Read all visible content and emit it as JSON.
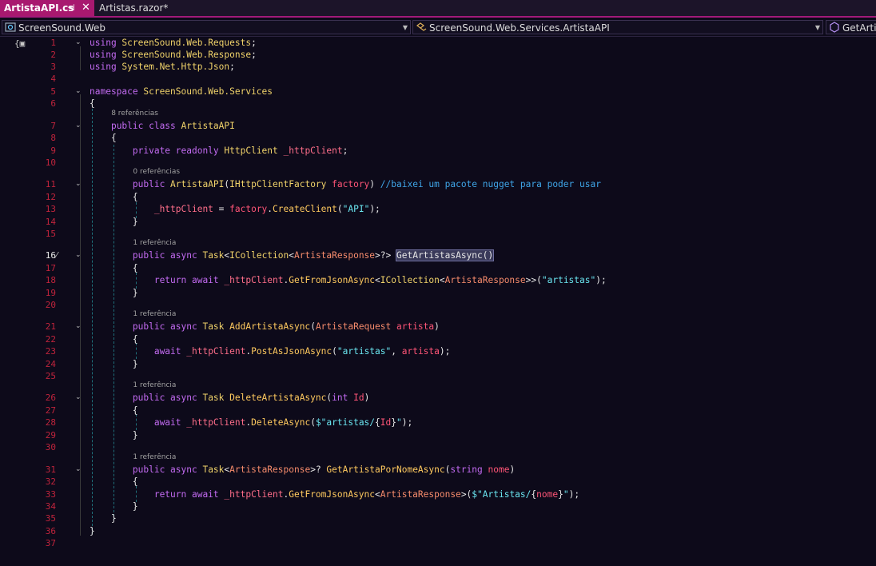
{
  "tabs": [
    {
      "label": "ArtistaAPI.cs",
      "active": true
    },
    {
      "label": "Artistas.razor*",
      "active": false
    }
  ],
  "tab_pin_glyph": "⊣",
  "tab_close_glyph": "✕",
  "nav": {
    "project": "ScreenSound.Web",
    "type": "ScreenSound.Web.Services.ArtistaAPI",
    "member": "GetArtist"
  },
  "colors": {
    "accent": "#a8196f",
    "line_number": "#c0243c",
    "keyword": "#c36bf2",
    "string": "#6ae5f0",
    "comment": "#3fa5e8"
  },
  "editor": {
    "current_line": 16,
    "lines": [
      {
        "n": "1",
        "code": [
          [
            "kw",
            "using "
          ],
          [
            "cls",
            "ScreenSound.Web.Requests"
          ],
          [
            "pl",
            ";"
          ]
        ]
      },
      {
        "n": "2",
        "code": [
          [
            "kw",
            "using "
          ],
          [
            "cls",
            "ScreenSound.Web.Response"
          ],
          [
            "pl",
            ";"
          ]
        ]
      },
      {
        "n": "3",
        "code": [
          [
            "kw",
            "using "
          ],
          [
            "cls",
            "System.Net.Http.Json"
          ],
          [
            "pl",
            ";"
          ]
        ]
      },
      {
        "n": "4",
        "code": []
      },
      {
        "n": "5",
        "code": [
          [
            "kw",
            "namespace "
          ],
          [
            "cls",
            "ScreenSound.Web.Services"
          ]
        ]
      },
      {
        "n": "6",
        "code": [
          [
            "pl",
            "{"
          ]
        ]
      },
      {
        "n": "7",
        "lens": "8 referências",
        "code": [
          [
            "pl",
            "    "
          ],
          [
            "kw",
            "public class "
          ],
          [
            "cls",
            "ArtistaAPI"
          ]
        ]
      },
      {
        "n": "8",
        "code": [
          [
            "pl",
            "    {"
          ]
        ]
      },
      {
        "n": "9",
        "code": [
          [
            "pl",
            "        "
          ],
          [
            "kw",
            "private readonly "
          ],
          [
            "cls",
            "HttpClient "
          ],
          [
            "fld",
            "_httpClient"
          ],
          [
            "pl",
            ";"
          ]
        ]
      },
      {
        "n": "10",
        "code": []
      },
      {
        "n": "11",
        "lens": "0 referências",
        "code": [
          [
            "pl",
            "        "
          ],
          [
            "kw",
            "public "
          ],
          [
            "cls",
            "ArtistaAPI"
          ],
          [
            "pl",
            "("
          ],
          [
            "cls",
            "IHttpClientFactory "
          ],
          [
            "par",
            "factory"
          ],
          [
            "pl",
            ") "
          ],
          [
            "cm",
            "//baixei um pacote nugget para poder usar"
          ]
        ]
      },
      {
        "n": "12",
        "code": [
          [
            "pl",
            "        {"
          ]
        ]
      },
      {
        "n": "13",
        "code": [
          [
            "pl",
            "            "
          ],
          [
            "fld",
            "_httpClient"
          ],
          [
            "pl",
            " = "
          ],
          [
            "par",
            "factory"
          ],
          [
            "pl",
            "."
          ],
          [
            "mth",
            "CreateClient"
          ],
          [
            "pl",
            "("
          ],
          [
            "str",
            "\"API\""
          ],
          [
            "pl",
            ");"
          ]
        ]
      },
      {
        "n": "14",
        "code": [
          [
            "pl",
            "        }"
          ]
        ]
      },
      {
        "n": "15",
        "code": []
      },
      {
        "n": "16",
        "lens": "1 referência",
        "code": [
          [
            "pl",
            "        "
          ],
          [
            "kw",
            "public async "
          ],
          [
            "cls",
            "Task"
          ],
          [
            "pl",
            "<"
          ],
          [
            "cls",
            "ICollection"
          ],
          [
            "pl",
            "<"
          ],
          [
            "ty",
            "ArtistaResponse"
          ],
          [
            "pl",
            ">?> "
          ],
          [
            "hl",
            "GetArtistasAsync()"
          ]
        ]
      },
      {
        "n": "17",
        "code": [
          [
            "pl",
            "        {"
          ]
        ]
      },
      {
        "n": "18",
        "code": [
          [
            "pl",
            "            "
          ],
          [
            "kw",
            "return await "
          ],
          [
            "fld",
            "_httpClient"
          ],
          [
            "pl",
            "."
          ],
          [
            "mth",
            "GetFromJsonAsync"
          ],
          [
            "pl",
            "<"
          ],
          [
            "cls",
            "ICollection"
          ],
          [
            "pl",
            "<"
          ],
          [
            "ty",
            "ArtistaResponse"
          ],
          [
            "pl",
            ">>("
          ],
          [
            "str",
            "\"artistas\""
          ],
          [
            "pl",
            ");"
          ]
        ]
      },
      {
        "n": "19",
        "code": [
          [
            "pl",
            "        }"
          ]
        ]
      },
      {
        "n": "20",
        "code": []
      },
      {
        "n": "21",
        "lens": "1 referência",
        "code": [
          [
            "pl",
            "        "
          ],
          [
            "kw",
            "public async "
          ],
          [
            "cls",
            "Task "
          ],
          [
            "mth",
            "AddArtistaAsync"
          ],
          [
            "pl",
            "("
          ],
          [
            "ty",
            "ArtistaRequest "
          ],
          [
            "par",
            "artista"
          ],
          [
            "pl",
            ")"
          ]
        ]
      },
      {
        "n": "22",
        "code": [
          [
            "pl",
            "        {"
          ]
        ]
      },
      {
        "n": "23",
        "code": [
          [
            "pl",
            "            "
          ],
          [
            "kw",
            "await "
          ],
          [
            "fld",
            "_httpClient"
          ],
          [
            "pl",
            "."
          ],
          [
            "mth",
            "PostAsJsonAsync"
          ],
          [
            "pl",
            "("
          ],
          [
            "str",
            "\"artistas\""
          ],
          [
            "pl",
            ", "
          ],
          [
            "par",
            "artista"
          ],
          [
            "pl",
            ");"
          ]
        ]
      },
      {
        "n": "24",
        "code": [
          [
            "pl",
            "        }"
          ]
        ]
      },
      {
        "n": "25",
        "code": []
      },
      {
        "n": "26",
        "lens": "1 referência",
        "code": [
          [
            "pl",
            "        "
          ],
          [
            "kw",
            "public async "
          ],
          [
            "cls",
            "Task "
          ],
          [
            "mth",
            "DeleteArtistaAsync"
          ],
          [
            "pl",
            "("
          ],
          [
            "kw",
            "int "
          ],
          [
            "par",
            "Id"
          ],
          [
            "pl",
            ")"
          ]
        ]
      },
      {
        "n": "27",
        "code": [
          [
            "pl",
            "        {"
          ]
        ]
      },
      {
        "n": "28",
        "code": [
          [
            "pl",
            "            "
          ],
          [
            "kw",
            "await "
          ],
          [
            "fld",
            "_httpClient"
          ],
          [
            "pl",
            "."
          ],
          [
            "mth",
            "DeleteAsync"
          ],
          [
            "pl",
            "("
          ],
          [
            "str",
            "$\"artistas/"
          ],
          [
            "pl",
            "{"
          ],
          [
            "par",
            "Id"
          ],
          [
            "pl",
            "}"
          ],
          [
            "str",
            "\""
          ],
          [
            "pl",
            ");"
          ]
        ]
      },
      {
        "n": "29",
        "code": [
          [
            "pl",
            "        }"
          ]
        ]
      },
      {
        "n": "30",
        "code": []
      },
      {
        "n": "31",
        "lens": "1 referência",
        "code": [
          [
            "pl",
            "        "
          ],
          [
            "kw",
            "public async "
          ],
          [
            "cls",
            "Task"
          ],
          [
            "pl",
            "<"
          ],
          [
            "ty",
            "ArtistaResponse"
          ],
          [
            "pl",
            ">? "
          ],
          [
            "mth",
            "GetArtistaPorNomeAsync"
          ],
          [
            "pl",
            "("
          ],
          [
            "kw",
            "string "
          ],
          [
            "par",
            "nome"
          ],
          [
            "pl",
            ")"
          ]
        ]
      },
      {
        "n": "32",
        "code": [
          [
            "pl",
            "        {"
          ]
        ]
      },
      {
        "n": "33",
        "code": [
          [
            "pl",
            "            "
          ],
          [
            "kw",
            "return await "
          ],
          [
            "fld",
            "_httpClient"
          ],
          [
            "pl",
            "."
          ],
          [
            "mth",
            "GetFromJsonAsync"
          ],
          [
            "pl",
            "<"
          ],
          [
            "ty",
            "ArtistaResponse"
          ],
          [
            "pl",
            ">("
          ],
          [
            "str",
            "$\"Artistas/"
          ],
          [
            "pl",
            "{"
          ],
          [
            "par",
            "nome"
          ],
          [
            "pl",
            "}"
          ],
          [
            "str",
            "\""
          ],
          [
            "pl",
            ");"
          ]
        ]
      },
      {
        "n": "34",
        "code": [
          [
            "pl",
            "        }"
          ]
        ]
      },
      {
        "n": "35",
        "code": [
          [
            "pl",
            "    }"
          ]
        ]
      },
      {
        "n": "36",
        "code": [
          [
            "pl",
            "}"
          ]
        ]
      },
      {
        "n": "37",
        "code": []
      }
    ]
  }
}
